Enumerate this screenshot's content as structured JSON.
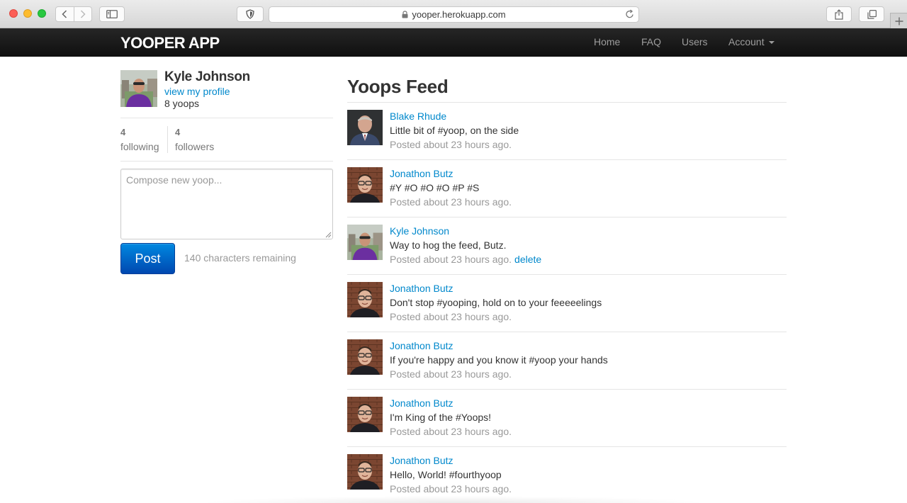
{
  "browser": {
    "url": "yooper.herokuapp.com",
    "icons": [
      "back-icon",
      "forward-icon",
      "sidebar-icon",
      "shield-icon",
      "lock-icon",
      "reload-icon",
      "share-icon",
      "tabs-icon",
      "plus-icon"
    ]
  },
  "navbar": {
    "brand": "YOOPER APP",
    "links": {
      "home": "Home",
      "faq": "FAQ",
      "users": "Users",
      "account": "Account"
    }
  },
  "profile": {
    "name": "Kyle Johnson",
    "view_profile": "view my profile",
    "yoop_count": "8 yoops",
    "following_count": "4",
    "following_label": "following",
    "followers_count": "4",
    "followers_label": "followers"
  },
  "compose": {
    "placeholder": "Compose new yoop...",
    "post_label": "Post",
    "chars_remaining": "140 characters remaining"
  },
  "feed": {
    "title": "Yoops Feed",
    "items": [
      {
        "user": "Blake Rhude",
        "content": "Little bit of #yoop, on the side",
        "time": "Posted about 23 hours ago.",
        "avatar": "blake"
      },
      {
        "user": "Jonathon Butz",
        "content": "#Y #O #O #O #P #S",
        "time": "Posted about 23 hours ago.",
        "avatar": "jonathon"
      },
      {
        "user": "Kyle Johnson",
        "content": "Way to hog the feed, Butz.",
        "time": "Posted about 23 hours ago.",
        "delete": "delete",
        "avatar": "kyle"
      },
      {
        "user": "Jonathon Butz",
        "content": "Don't stop #yooping, hold on to your feeeeelings",
        "time": "Posted about 23 hours ago.",
        "avatar": "jonathon"
      },
      {
        "user": "Jonathon Butz",
        "content": "If you're happy and you know it #yoop your hands",
        "time": "Posted about 23 hours ago.",
        "avatar": "jonathon"
      },
      {
        "user": "Jonathon Butz",
        "content": "I'm King of the #Yoops!",
        "time": "Posted about 23 hours ago.",
        "avatar": "jonathon"
      },
      {
        "user": "Jonathon Butz",
        "content": "Hello, World! #fourthyoop",
        "time": "Posted about 23 hours ago.",
        "avatar": "jonathon"
      }
    ]
  },
  "colors": {
    "navbar": "#1b1b1b",
    "link": "#0088cc",
    "muted": "#999999",
    "post_button": "#006dcc"
  }
}
